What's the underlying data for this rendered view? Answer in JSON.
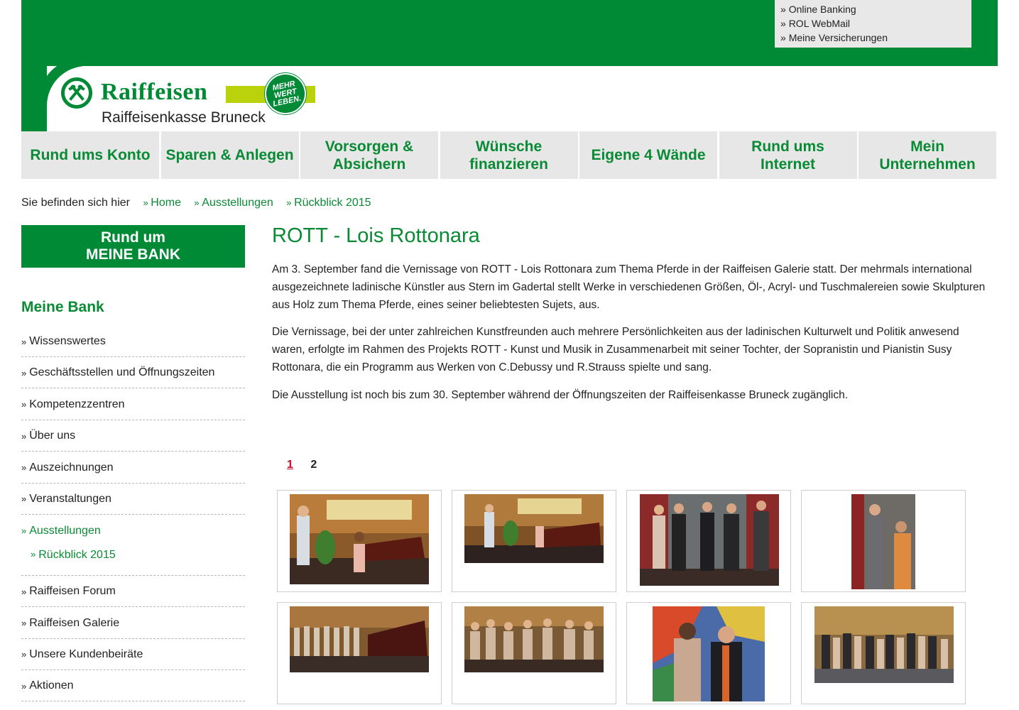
{
  "quicklinks": {
    "items": [
      "Online Banking",
      "ROL WebMail",
      "Meine Versicherungen"
    ]
  },
  "logo": {
    "brand": "Raiffeisen",
    "subtitle": "Raiffeisenkasse Bruneck",
    "badge_lines": [
      "MEHR",
      "WERT",
      "LEBEN."
    ]
  },
  "nav": {
    "items": [
      "Rund ums Konto",
      "Sparen & Anlegen",
      "Vorsorgen & Absichern",
      "Wünsche finanzieren",
      "Eigene 4 Wände",
      "Rund ums Internet",
      "Mein Unternehmen"
    ]
  },
  "breadcrumb": {
    "label": "Sie befinden sich hier",
    "items": [
      "Home",
      "Ausstellungen",
      "Rückblick 2015"
    ]
  },
  "sidebar": {
    "button_line1": "Rund um",
    "button_line2": "MEINE BANK",
    "heading": "Meine Bank",
    "items": [
      "Wissenswertes",
      "Geschäftsstellen und Öffnungszeiten",
      "Kompetenzzentren",
      "Über uns",
      "Auszeichnungen",
      "Veranstaltungen",
      "Ausstellungen",
      "Rückblick 2015",
      "Raiffeisen Forum",
      "Raiffeisen Galerie",
      "Unsere Kundenbeiräte",
      "Aktionen"
    ],
    "active_item": "Ausstellungen",
    "sub_item": "Rückblick 2015"
  },
  "article": {
    "title": "ROTT - Lois Rottonara",
    "p1": "Am 3. September fand die Vernissage von ROTT - Lois Rottonara zum Thema Pferde in der Raiffeisen Galerie statt. Der mehrmals international ausgezeichnete ladinische Künstler aus Stern im Gadertal stellt Werke in verschiedenen Größen, Öl-, Acryl- und Tuschmalereien sowie Skulpturen aus Holz zum Thema Pferde, eines seiner beliebtesten Sujets, aus.",
    "p2": "Die Vernissage, bei der unter zahlreichen Kunstfreunden auch mehrere Persönlichkeiten aus der ladinischen Kulturwelt und Politik anwesend waren, erfolgte im Rahmen des Projekts ROTT - Kunst und Musik in Zusammenarbeit mit seiner Tochter, der Sopranistin und Pianistin Susy Rottonara, die ein Programm aus Werken von C.Debussy und R.Strauss spielte und sang.",
    "p3": "Die Ausstellung ist noch bis zum 30. September während der Öffnungszeiten der Raiffeisenkasse Bruneck zugänglich."
  },
  "pager": {
    "pages": [
      "1",
      "2"
    ],
    "current": "1"
  },
  "colors": {
    "brand_green": "#008a35",
    "lime": "#b9d20c",
    "nav_bg": "#e7e7e7",
    "active_page": "#c8102e"
  }
}
